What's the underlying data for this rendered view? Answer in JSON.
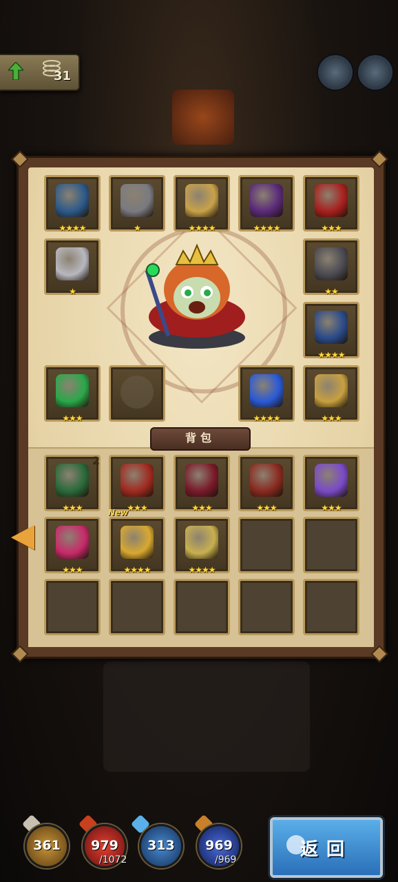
{
  "top": {
    "level_value": "31",
    "avatars": [
      "character-portrait-1",
      "character-portrait-2"
    ]
  },
  "equipped": [
    {
      "id": "gauntlet",
      "stars": "★★★★",
      "color": "#2d5a8a"
    },
    {
      "id": "chest-armor",
      "stars": "★",
      "color": "#7a7a80"
    },
    {
      "id": "feather-helm",
      "stars": "★★★★",
      "color": "#c9a24a"
    },
    {
      "id": "purple-lantern",
      "stars": "★★★★",
      "color": "#5a2a7a"
    },
    {
      "id": "red-bead-necklace",
      "stars": "★★★",
      "color": "#a8201e"
    },
    {
      "id": "silver-ring",
      "stars": "★",
      "color": "#b8b8c0"
    },
    {
      "id": "dark-ring",
      "stars": "★★",
      "color": "#4a4a52"
    },
    {
      "id": "knight-armor",
      "stars": "★★★★",
      "color": "#2a4a8a"
    },
    {
      "id": "emerald-scepter",
      "stars": "★★★",
      "color": "#2aa84a"
    },
    {
      "id": "empty-pet-slot",
      "stars": "",
      "color": "#6a5e4a"
    },
    {
      "id": "blue-eye-orb",
      "stars": "★★★★",
      "color": "#2a5ad8"
    },
    {
      "id": "golden-boots",
      "stars": "★★★",
      "color": "#c8a040"
    }
  ],
  "bag_label": "背包",
  "bag": [
    {
      "id": "fur-cloak",
      "stars": "★★★",
      "count": "2",
      "new": "",
      "color": "#2a6a3a"
    },
    {
      "id": "red-dragon-helm",
      "stars": "★★★",
      "count": "",
      "new": "",
      "color": "#a02a20"
    },
    {
      "id": "crimson-robe",
      "stars": "★★★",
      "count": "",
      "new": "",
      "color": "#7a1a2a"
    },
    {
      "id": "red-bracer",
      "stars": "★★★",
      "count": "",
      "new": "",
      "color": "#8a2a20"
    },
    {
      "id": "amethyst-ring",
      "stars": "★★★",
      "count": "",
      "new": "",
      "color": "#7a4ac8"
    },
    {
      "id": "ruby-pendant",
      "stars": "★★★",
      "count": "",
      "new": "",
      "color": "#c82a6a"
    },
    {
      "id": "golden-chestplate",
      "stars": "★★★★",
      "count": "",
      "new": "New",
      "color": "#d8a830"
    },
    {
      "id": "golden-gauntlet",
      "stars": "★★★★",
      "count": "",
      "new": "",
      "color": "#c8b050"
    },
    {
      "id": "empty",
      "stars": "",
      "count": "",
      "new": "",
      "color": ""
    },
    {
      "id": "empty",
      "stars": "",
      "count": "",
      "new": "",
      "color": ""
    },
    {
      "id": "empty",
      "stars": "",
      "count": "",
      "new": "",
      "color": ""
    },
    {
      "id": "empty",
      "stars": "",
      "count": "",
      "new": "",
      "color": ""
    },
    {
      "id": "empty",
      "stars": "",
      "count": "",
      "new": "",
      "color": ""
    },
    {
      "id": "empty",
      "stars": "",
      "count": "",
      "new": "",
      "color": ""
    },
    {
      "id": "empty",
      "stars": "",
      "count": "",
      "new": "",
      "color": ""
    }
  ],
  "stats": {
    "attack": {
      "value": "361",
      "color": "#8a6a2a"
    },
    "hp": {
      "value": "979",
      "max": "/1072",
      "color": "#a8201e"
    },
    "defense": {
      "value": "313",
      "color": "#2a5a8a"
    },
    "mana": {
      "value": "969",
      "max": "/969",
      "color": "#2a4a9a"
    }
  },
  "return_label": "返回"
}
